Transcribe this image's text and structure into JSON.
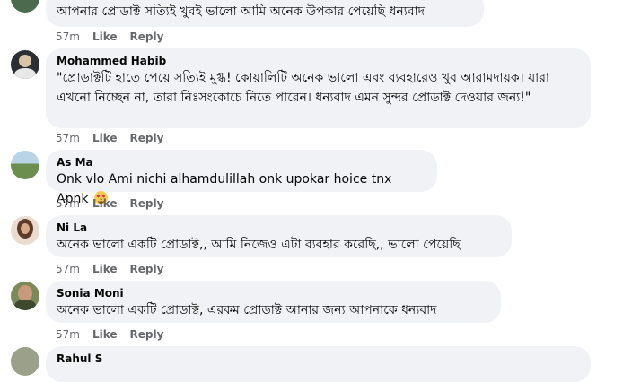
{
  "comments": [
    {
      "author": "",
      "text": "আপনার প্রোডাক্ট সত্যিই খুবই ভালো আমি অনেক উপকার পেয়েছি ধন্যবাদ",
      "time": "57m",
      "like": "Like",
      "reply": "Reply",
      "avatar_color": "#4a6b4d"
    },
    {
      "author": "Mohammed Habib",
      "text": "\"প্রোডাক্টটি হাতে পেয়ে সত্যিই মুগ্ধ! কোয়ালিটি অনেক ভালো এবং ব্যবহারেও খুব আরামদায়ক। যারা এখনো নিচ্ছেন না, তারা নিঃসংকোচে নিতে পারেন। ধন্যবাদ এমন সুন্দর প্রোডাক্ট দেওয়ার জন্য!\"",
      "time": "57m",
      "like": "Like",
      "reply": "Reply",
      "avatar_color": "#2b2f33"
    },
    {
      "author": "As Ma",
      "text": "Onk vlo Ami nichi alhamdulillah onk upokar hoice tnx Apnk",
      "emoji": "smiling-face-with-hearts",
      "time": "57m",
      "like": "Like",
      "reply": "Reply",
      "avatar_color": "#6b8e4e"
    },
    {
      "author": "Ni La",
      "text": "অনেক ভালো একটি প্রোডাক্ট,, আমি নিজেও এটা ব্যবহার করেছি,, ভালো পেয়েছি",
      "time": "57m",
      "like": "Like",
      "reply": "Reply",
      "avatar_color": "#8a6f5c"
    },
    {
      "author": "Sonia Moni",
      "text": "অনেক ভালো একটি প্রোডাক্ট, এরকম প্রোডাক্ট আনার জন্য আপনাকে ধন্যবাদ",
      "time": "57m",
      "like": "Like",
      "reply": "Reply",
      "avatar_color": "#7c8a5a"
    },
    {
      "author": "Rahul S",
      "text": "",
      "time": "",
      "like": "",
      "reply": "",
      "avatar_color": "#9aa08a"
    }
  ]
}
